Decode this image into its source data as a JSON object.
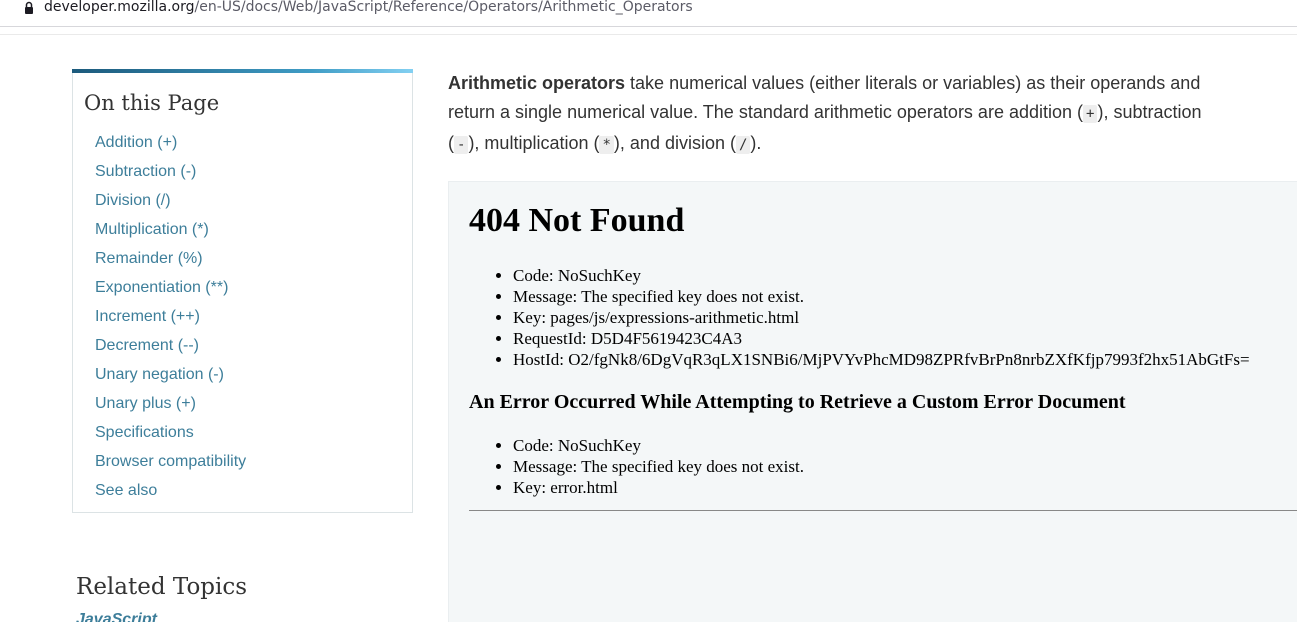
{
  "browser": {
    "url_domain": "developer.mozilla.org",
    "url_path": "/en-US/docs/Web/JavaScript/Reference/Operators/Arithmetic_Operators",
    "icon": "lock-icon"
  },
  "sidebar": {
    "title": "On this Page",
    "items": [
      {
        "label": "Addition (+)"
      },
      {
        "label": "Subtraction (-)"
      },
      {
        "label": "Division (/)"
      },
      {
        "label": "Multiplication (*)"
      },
      {
        "label": "Remainder (%)"
      },
      {
        "label": "Exponentiation (**)"
      },
      {
        "label": "Increment (++)"
      },
      {
        "label": "Decrement (--)"
      },
      {
        "label": "Unary negation (-)"
      },
      {
        "label": "Unary plus (+)"
      },
      {
        "label": "Specifications"
      },
      {
        "label": "Browser compatibility"
      },
      {
        "label": "See also"
      }
    ],
    "related_title": "Related Topics",
    "related_link": "JavaScript"
  },
  "intro": {
    "strong": "Arithmetic operators",
    "text1": " take numerical values (either literals or variables) as their operands and return a single numerical value. The standard arithmetic operators are addition (",
    "code_add": "+",
    "text2": "), subtraction (",
    "code_sub": "-",
    "text3": "), multiplication (",
    "code_mul": "*",
    "text4": "), and division (",
    "code_div": "/",
    "text5": ")."
  },
  "error": {
    "title": "404 Not Found",
    "items": [
      "Code: NoSuchKey",
      "Message: The specified key does not exist.",
      "Key: pages/js/expressions-arithmetic.html",
      "RequestId: D5D4F5619423C4A3",
      "HostId: O2/fgNk8/6DgVqR3qLX1SNBi6/MjPVYvPhcMD98ZPRfvBrPn8nrbZXfKfjp7993f2hx51AbGtFs="
    ],
    "subtitle": "An Error Occurred While Attempting to Retrieve a Custom Error Document",
    "items2": [
      "Code: NoSuchKey",
      "Message: The specified key does not exist.",
      "Key: error.html"
    ]
  },
  "colors": {
    "link": "#3d7e9a",
    "text": "#333333",
    "frame_bg": "#f4f7f8"
  }
}
